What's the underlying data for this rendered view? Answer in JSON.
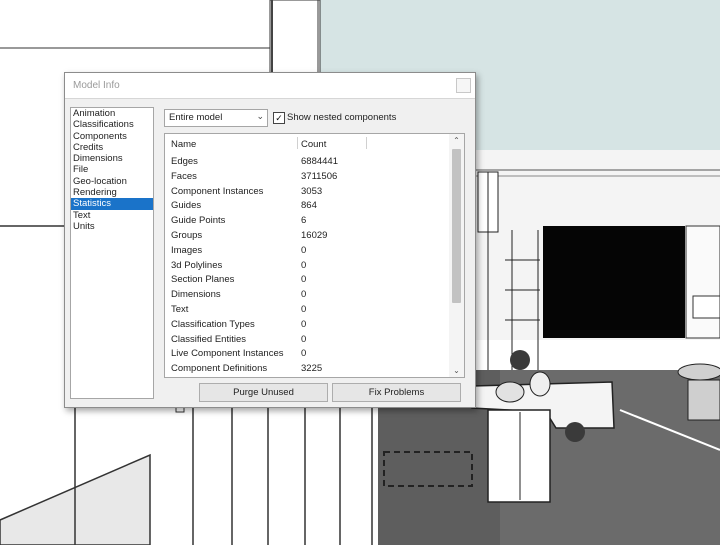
{
  "dialog": {
    "title": "Model Info",
    "sidebar": {
      "items": [
        {
          "label": "Animation"
        },
        {
          "label": "Classifications"
        },
        {
          "label": "Components"
        },
        {
          "label": "Credits"
        },
        {
          "label": "Dimensions"
        },
        {
          "label": "File"
        },
        {
          "label": "Geo-location"
        },
        {
          "label": "Rendering"
        },
        {
          "label": "Statistics",
          "selected": true
        },
        {
          "label": "Text"
        },
        {
          "label": "Units"
        }
      ]
    },
    "scope_select": {
      "value": "Entire model"
    },
    "nested_checkbox": {
      "label": "Show nested components",
      "checked": true
    },
    "stats": {
      "header_name": "Name",
      "header_count": "Count",
      "rows": [
        {
          "name": "Edges",
          "count": "6884441"
        },
        {
          "name": "Faces",
          "count": "3711506"
        },
        {
          "name": "Component Instances",
          "count": "3053"
        },
        {
          "name": "Guides",
          "count": "864"
        },
        {
          "name": "Guide Points",
          "count": "6"
        },
        {
          "name": "Groups",
          "count": "16029"
        },
        {
          "name": "Images",
          "count": "0"
        },
        {
          "name": "3d Polylines",
          "count": "0"
        },
        {
          "name": "Section Planes",
          "count": "0"
        },
        {
          "name": "Dimensions",
          "count": "0"
        },
        {
          "name": "Text",
          "count": "0"
        },
        {
          "name": "Classification Types",
          "count": "0"
        },
        {
          "name": "Classified Entities",
          "count": "0"
        },
        {
          "name": "Live Component Instances",
          "count": "0"
        },
        {
          "name": "Component Definitions",
          "count": "3225"
        }
      ]
    },
    "buttons": {
      "purge_label": "Purge Unused",
      "fix_label": "Fix Problems"
    }
  },
  "colors": {
    "selection": "#1a73c9",
    "sky": "#d6e4e4",
    "floor": "#6b6b6b"
  }
}
